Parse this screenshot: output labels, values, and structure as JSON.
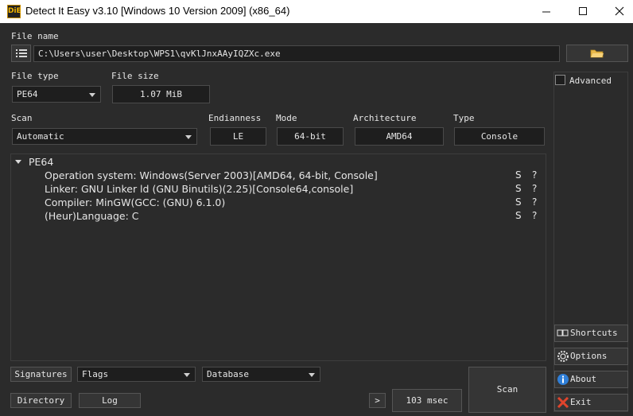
{
  "window": {
    "title": "Detect It Easy v3.10 [Windows 10 Version 2009] (x86_64)",
    "icon_text": "DiE"
  },
  "file": {
    "label": "File name",
    "path": "C:\\Users\\user\\Desktop\\WPS1\\qvKlJnxAAyIQZXc.exe"
  },
  "file_type": {
    "label": "File type",
    "value": "PE64"
  },
  "file_size": {
    "label": "File size",
    "value": "1.07 MiB"
  },
  "advanced": {
    "label": "Advanced",
    "checked": false
  },
  "scan": {
    "label": "Scan",
    "value": "Automatic"
  },
  "endianness": {
    "label": "Endianness",
    "value": "LE"
  },
  "mode": {
    "label": "Mode",
    "value": "64-bit"
  },
  "architecture": {
    "label": "Architecture",
    "value": "AMD64"
  },
  "type": {
    "label": "Type",
    "value": "Console"
  },
  "results": {
    "root": "PE64",
    "items": [
      {
        "text": "Operation system: Windows(Server 2003)[AMD64, 64-bit, Console]",
        "s": "S",
        "q": "?"
      },
      {
        "text": "Linker: GNU Linker ld (GNU Binutils)(2.25)[Console64,console]",
        "s": "S",
        "q": "?"
      },
      {
        "text": "Compiler: MinGW(GCC: (GNU) 6.1.0)",
        "s": "S",
        "q": "?"
      },
      {
        "text": "(Heur)Language: C",
        "s": "S",
        "q": "?"
      }
    ]
  },
  "bottom": {
    "signatures": "Signatures",
    "flags": "Flags",
    "database": "Database",
    "directory": "Directory",
    "log": "Log",
    "next": ">",
    "time": "103 msec",
    "scan": "Scan"
  },
  "side": {
    "shortcuts": "Shortcuts",
    "options": "Options",
    "about": "About",
    "exit": "Exit"
  },
  "colors": {
    "accent": "#f1b400",
    "background": "#2b2b2b",
    "field": "#1e1e1e"
  }
}
